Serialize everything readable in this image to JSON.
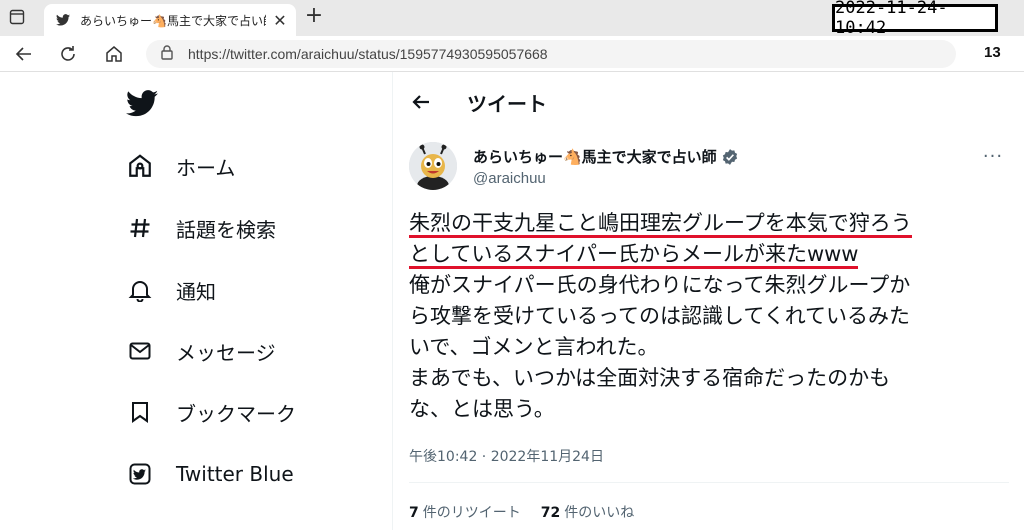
{
  "browser": {
    "tab_title": "あらいちゅー🐴馬主で大家で占い師",
    "tab_close": "✕",
    "new_tab": "+",
    "url": "https://twitter.com/araichuu/status/1595774930595057668",
    "tab_count": "13",
    "timestamp": "2022-11-24-10:42"
  },
  "sidebar": {
    "items": [
      {
        "label": "ホーム",
        "icon": "home-icon"
      },
      {
        "label": "話題を検索",
        "icon": "hashtag-icon"
      },
      {
        "label": "通知",
        "icon": "bell-icon"
      },
      {
        "label": "メッセージ",
        "icon": "mail-icon"
      },
      {
        "label": "ブックマーク",
        "icon": "bookmark-icon"
      },
      {
        "label": "Twitter Blue",
        "icon": "twitter-blue-icon"
      }
    ]
  },
  "main": {
    "header_title": "ツイート",
    "tweet": {
      "author_name": "あらいちゅー🐴馬主で大家で占い師",
      "handle": "@araichuu",
      "lines": [
        "朱烈の干支九星こと嶋田理宏グループを本気で狩ろう",
        "としているスナイパー氏からメールが来たwww",
        "俺がスナイパー氏の身代わりになって朱烈グループか",
        "ら攻撃を受けているってのは認識してくれているみた",
        "いで、ゴメンと言われた。",
        "まあでも、いつかは全面対決する宿命だったのかも",
        "な、とは思う。"
      ],
      "time": "午後10:42 · 2022年11月24日",
      "retweets_count": "7",
      "retweets_label": "件のリツイート",
      "likes_count": "72",
      "likes_label": "件のいいね"
    }
  },
  "colors": {
    "accent": "#1d9bf0",
    "underline": "#e0112b",
    "text": "#0f1419",
    "muted": "#536471"
  }
}
